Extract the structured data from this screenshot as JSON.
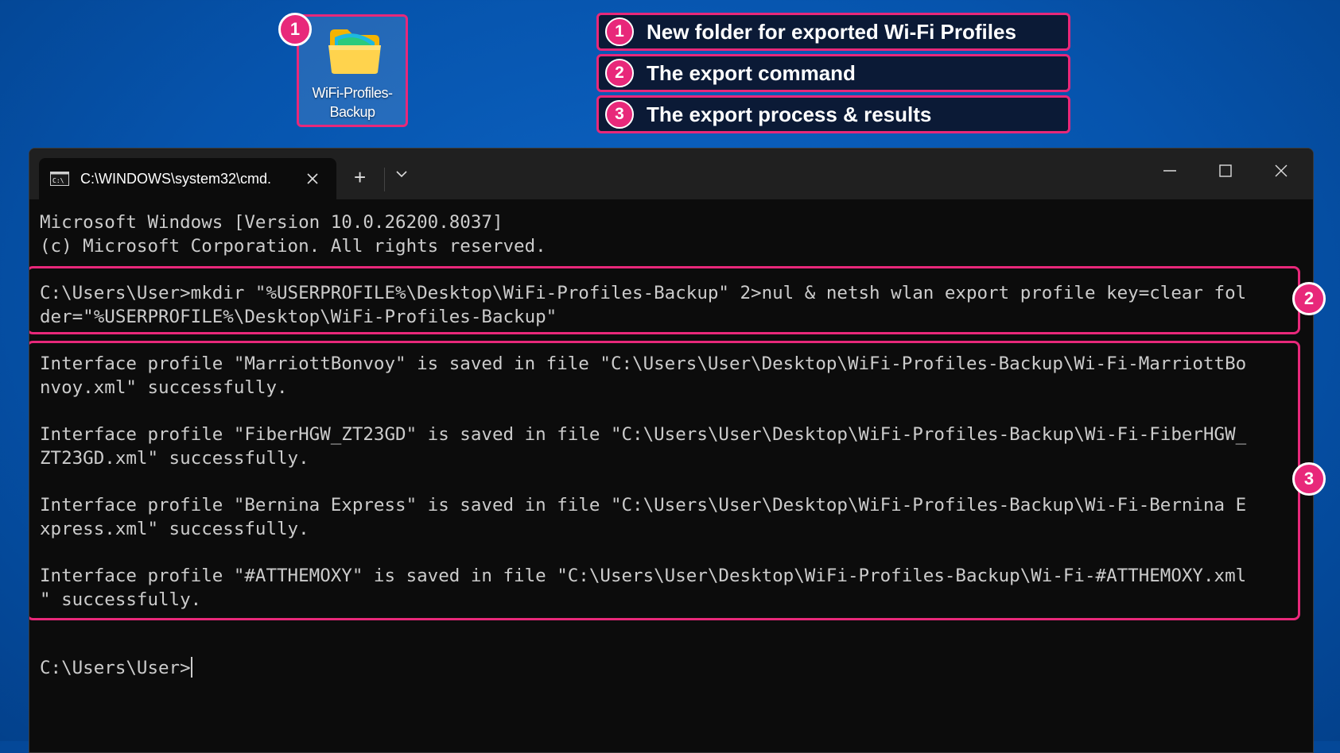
{
  "desktop": {
    "icon_label": "WiFi-Profiles-Backup",
    "icon_name": "folder-icon",
    "callout_number": "1"
  },
  "legend": [
    {
      "num": "1",
      "text": "New folder for exported Wi-Fi Profiles"
    },
    {
      "num": "2",
      "text": "The export command"
    },
    {
      "num": "3",
      "text": "The export process & results"
    }
  ],
  "terminal": {
    "tab_title": "C:\\WINDOWS\\system32\\cmd.",
    "new_tab_label": "+",
    "lines": {
      "l1": "Microsoft Windows [Version 10.0.26200.8037]",
      "l2": "(c) Microsoft Corporation. All rights reserved.",
      "cmd1": "C:\\Users\\User>mkdir \"%USERPROFILE%\\Desktop\\WiFi-Profiles-Backup\" 2>nul & netsh wlan export profile key=clear fol",
      "cmd2": "der=\"%USERPROFILE%\\Desktop\\WiFi-Profiles-Backup\"",
      "r1a": "Interface profile \"MarriottBonvoy\" is saved in file \"C:\\Users\\User\\Desktop\\WiFi-Profiles-Backup\\Wi-Fi-MarriottBo",
      "r1b": "nvoy.xml\" successfully.",
      "r2a": "Interface profile \"FiberHGW_ZT23GD\" is saved in file \"C:\\Users\\User\\Desktop\\WiFi-Profiles-Backup\\Wi-Fi-FiberHGW_",
      "r2b": "ZT23GD.xml\" successfully.",
      "r3a": "Interface profile \"Bernina Express\" is saved in file \"C:\\Users\\User\\Desktop\\WiFi-Profiles-Backup\\Wi-Fi-Bernina E",
      "r3b": "xpress.xml\" successfully.",
      "r4a": "Interface profile \"#ATTHEMOXY\" is saved in file \"C:\\Users\\User\\Desktop\\WiFi-Profiles-Backup\\Wi-Fi-#ATTHEMOXY.xml",
      "r4b": "\" successfully.",
      "prompt": "C:\\Users\\User>"
    },
    "callouts": {
      "command": "2",
      "results": "3"
    }
  },
  "colors": {
    "accent": "#e8287a",
    "desktop_bg": "#0654ad",
    "terminal_bg": "#0c0c0c",
    "terminal_text": "#cccccc"
  }
}
